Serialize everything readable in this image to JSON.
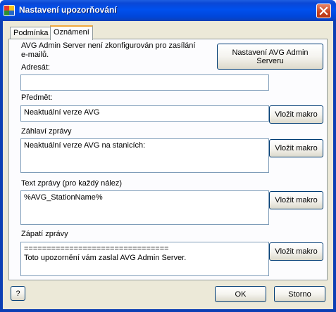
{
  "window": {
    "title": "Nastavení upozorňování"
  },
  "tabs": [
    {
      "label": "Podmínka",
      "active": false
    },
    {
      "label": "Oznámení",
      "active": true
    }
  ],
  "server_note": {
    "line1": "AVG Admin Server není zkonfigurován pro zasílání",
    "line2": "e-mailů."
  },
  "server_settings_button": {
    "line1": "Nastavení AVG Admin",
    "line2": "Serveru"
  },
  "recipient": {
    "label": "Adresát:",
    "value": ""
  },
  "subject": {
    "label": "Předmět:",
    "value": "Neaktuální verze AVG"
  },
  "header": {
    "label": "Záhlaví zprávy",
    "value": "Neaktuální verze AVG na stanicích:"
  },
  "body": {
    "label": "Text zprávy (pro každý nález)",
    "value": "%AVG_StationName%"
  },
  "footer": {
    "label": "Zápatí zprávy",
    "line1": "================================",
    "line2": "Toto upozornění vám zaslal AVG Admin Server."
  },
  "insert_macro_label": "Vložit makro",
  "help_button": "?",
  "ok_button": "OK",
  "cancel_button": "Storno",
  "colors": {
    "titlebar": "#0050ee",
    "dialog_bg": "#ece9d8",
    "tab_accent": "#f1a83b",
    "close_button": "#c8431f"
  },
  "icons": {
    "app": "avg-icon",
    "close": "close-icon"
  }
}
